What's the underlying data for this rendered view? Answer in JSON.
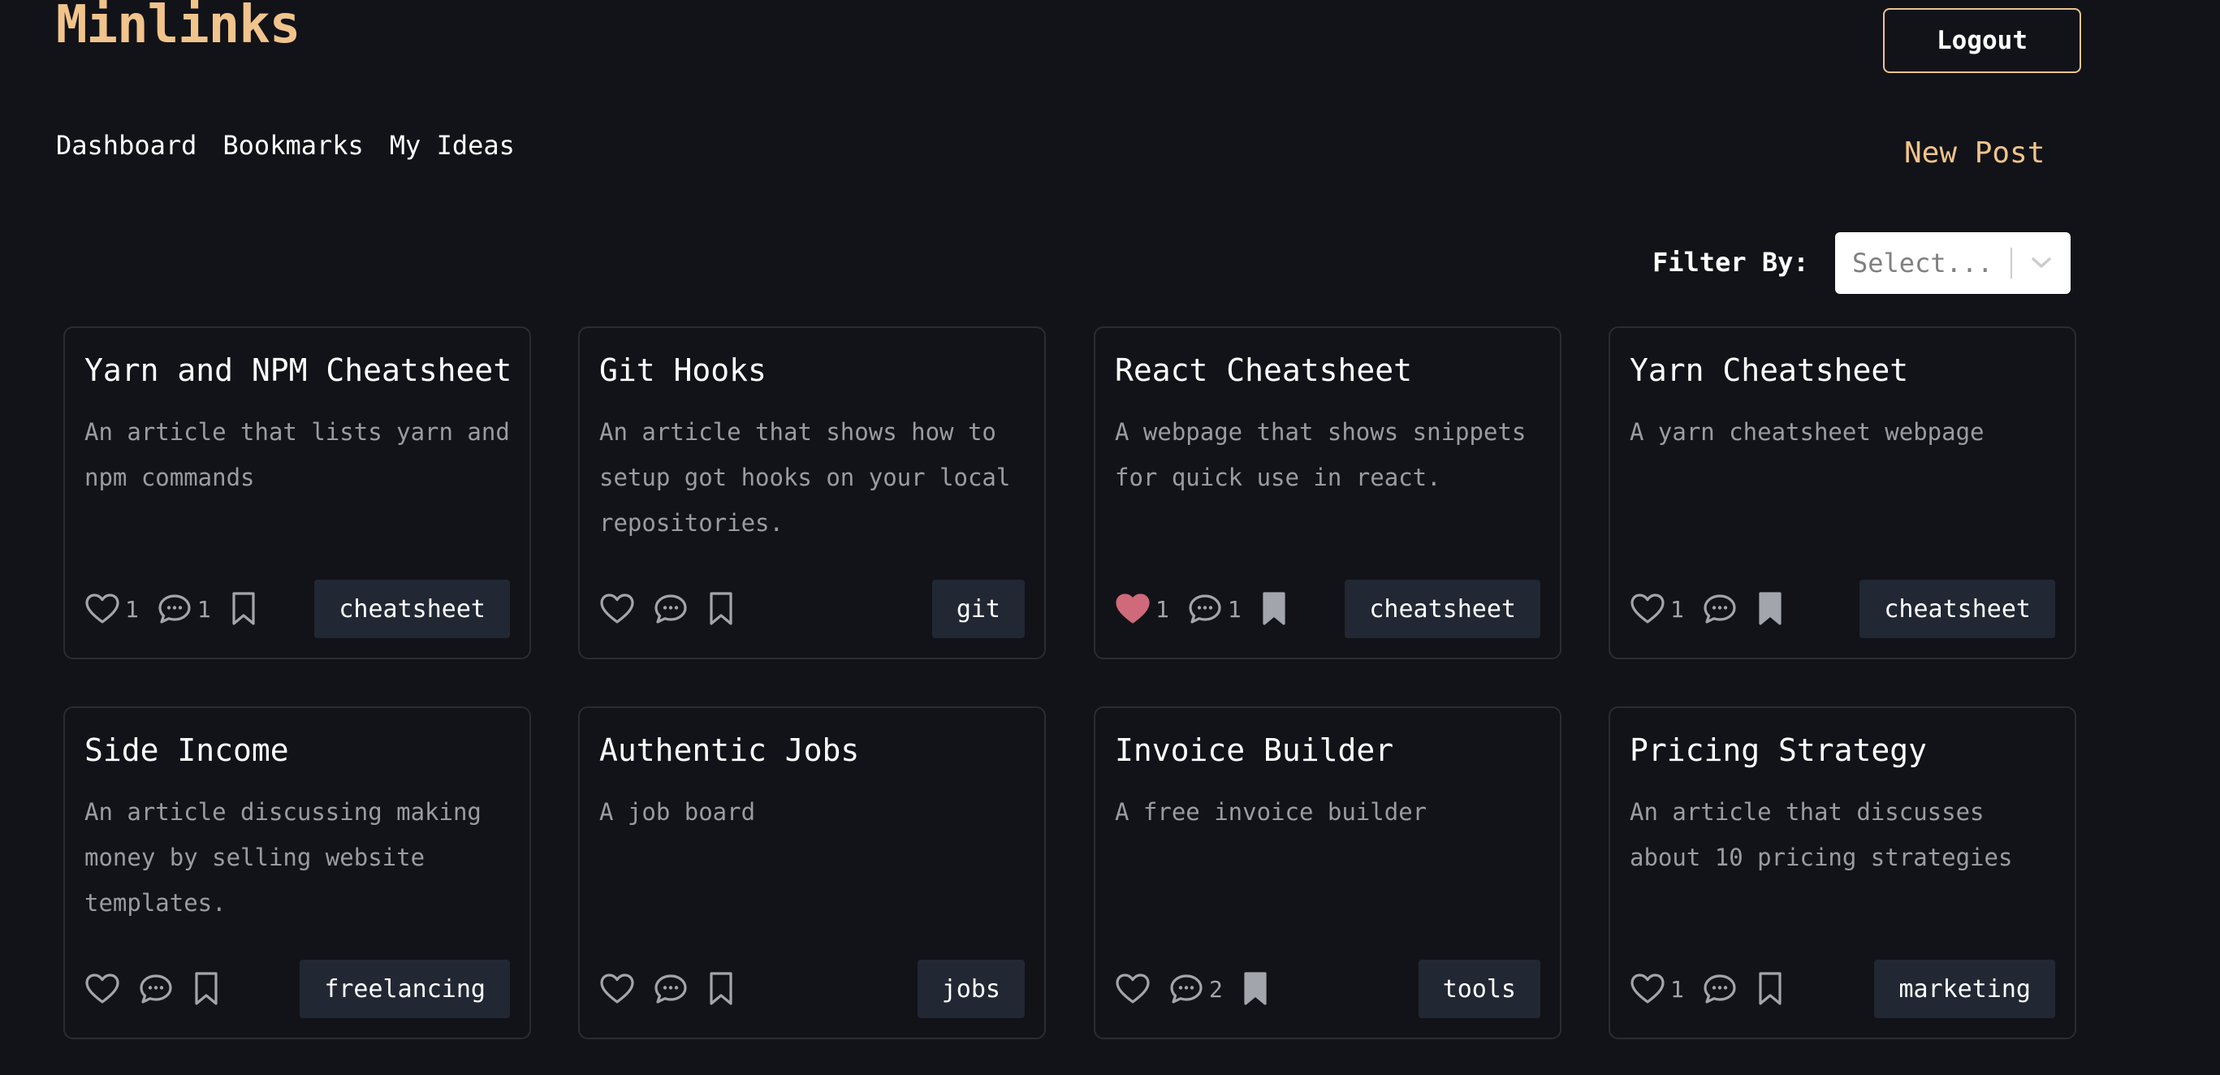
{
  "header": {
    "brand": "Minlinks",
    "logout_label": "Logout"
  },
  "nav": {
    "items": [
      "Dashboard",
      "Bookmarks",
      "My Ideas"
    ],
    "new_post_label": "New Post"
  },
  "filter": {
    "label": "Filter By:",
    "placeholder": "Select..."
  },
  "colors": {
    "accent": "#f0c48b",
    "liked": "#d06a7a",
    "icon": "#a3a5ac",
    "tag_bg": "#222734"
  },
  "cards": [
    {
      "title": "Yarn and NPM Cheatsheet",
      "description": "An article that lists yarn and npm commands",
      "likes": "1",
      "liked": false,
      "comments": "1",
      "bookmarked": false,
      "tag": "cheatsheet"
    },
    {
      "title": "Git Hooks",
      "description": "An article that shows how to setup got hooks on your local repositories.",
      "likes": "",
      "liked": false,
      "comments": "",
      "bookmarked": false,
      "tag": "git"
    },
    {
      "title": "React Cheatsheet",
      "description": "A webpage that shows snippets for quick use in react.",
      "likes": "1",
      "liked": true,
      "comments": "1",
      "bookmarked": true,
      "tag": "cheatsheet"
    },
    {
      "title": "Yarn Cheatsheet",
      "description": "A yarn cheatsheet webpage",
      "likes": "1",
      "liked": false,
      "comments": "",
      "bookmarked": true,
      "tag": "cheatsheet"
    },
    {
      "title": "Side Income",
      "description": "An article discussing making money by selling website templates.",
      "likes": "",
      "liked": false,
      "comments": "",
      "bookmarked": false,
      "tag": "freelancing"
    },
    {
      "title": "Authentic Jobs",
      "description": "A job board",
      "likes": "",
      "liked": false,
      "comments": "",
      "bookmarked": false,
      "tag": "jobs"
    },
    {
      "title": "Invoice Builder",
      "description": "A free invoice builder",
      "likes": "",
      "liked": false,
      "comments": "2",
      "bookmarked": true,
      "tag": "tools"
    },
    {
      "title": "Pricing Strategy",
      "description": "An article that discusses about 10 pricing strategies",
      "likes": "1",
      "liked": false,
      "comments": "",
      "bookmarked": false,
      "tag": "marketing"
    }
  ]
}
